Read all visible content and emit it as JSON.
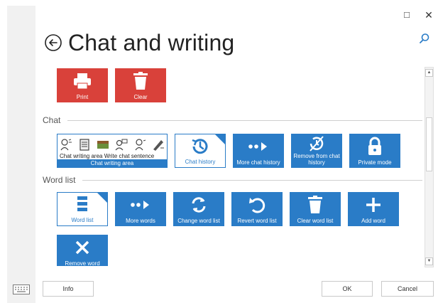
{
  "window": {
    "maximize_glyph": "□",
    "close_glyph": "✕"
  },
  "page": {
    "title": "Chat and writing"
  },
  "top_tiles": [
    {
      "label": "Print",
      "icon": "printer-icon"
    },
    {
      "label": "Clear",
      "icon": "trash-icon"
    }
  ],
  "chat": {
    "header": "Chat",
    "writing_area": {
      "words": "Chat writing area  Write chat sentence",
      "label": "Chat writing area"
    },
    "tiles": [
      {
        "label": "Chat history",
        "icon": "history-icon"
      },
      {
        "label": "More chat history",
        "icon": "more-arrow-icon"
      },
      {
        "label": "Remove from chat history",
        "icon": "remove-history-icon"
      },
      {
        "label": "Private mode",
        "icon": "lock-icon"
      }
    ]
  },
  "word_list": {
    "header": "Word list",
    "tiles": [
      {
        "label": "Word list",
        "icon": "list-icon"
      },
      {
        "label": "More words",
        "icon": "more-arrow-icon"
      },
      {
        "label": "Change word list",
        "icon": "refresh-icon"
      },
      {
        "label": "Revert word list",
        "icon": "undo-icon"
      },
      {
        "label": "Clear word list",
        "icon": "trash-icon"
      },
      {
        "label": "Add word",
        "icon": "plus-icon"
      },
      {
        "label": "Remove word",
        "icon": "close-icon"
      }
    ]
  },
  "footer": {
    "info_label": "Info",
    "ok_label": "OK",
    "cancel_label": "Cancel"
  },
  "colors": {
    "red": "#d9413a",
    "blue": "#2a7cc7"
  }
}
